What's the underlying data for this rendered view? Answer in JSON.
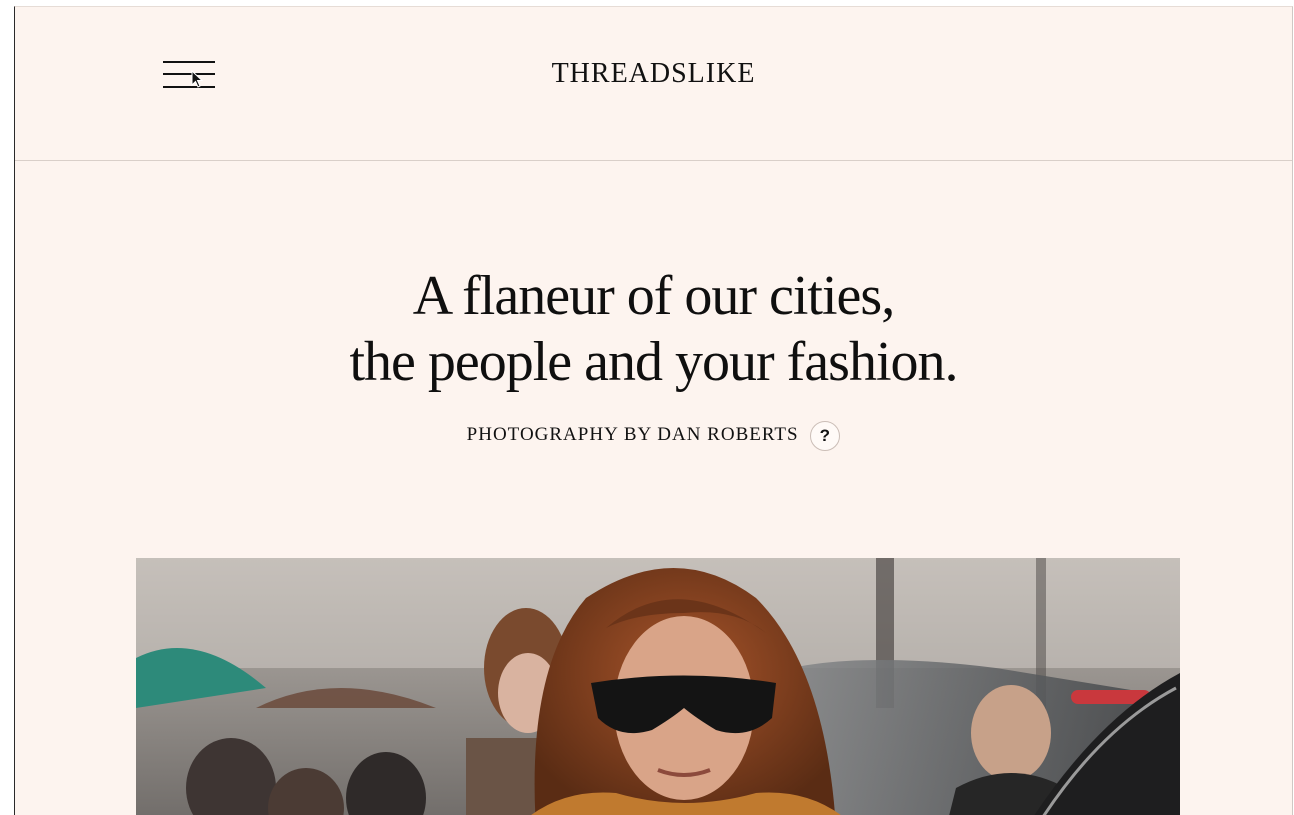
{
  "header": {
    "brand": "THREADSLIKE"
  },
  "hero": {
    "title_line1": "A flaneur of our cities,",
    "title_line2": "the people and your fashion.",
    "byline": "PHOTOGRAPHY BY DAN ROBERTS",
    "help_label": "?"
  },
  "icons": {
    "menu": "hamburger-menu-icon",
    "cursor": "mouse-pointer-icon",
    "help": "question-mark-icon"
  },
  "colors": {
    "background": "#fdf4ef",
    "text": "#111111",
    "divider": "#d9cfc9"
  }
}
